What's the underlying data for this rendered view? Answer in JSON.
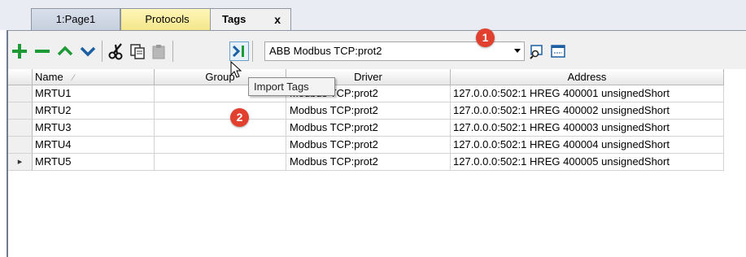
{
  "tabs": [
    {
      "label": "1:Page1"
    },
    {
      "label": "Protocols"
    },
    {
      "label": "Tags",
      "close": "x"
    }
  ],
  "toolbar": {
    "buttons": [
      "add-icon",
      "remove-icon",
      "move-up-icon",
      "move-down-icon",
      "cut-icon",
      "copy-icon",
      "paste-icon",
      "import-tags-icon"
    ],
    "protocol_selected": "ABB Modbus TCP:prot2",
    "extra_icons": [
      "tag-browser-icon",
      "window-icon"
    ]
  },
  "table": {
    "columns": [
      "Name",
      "Group",
      "Driver",
      "Address"
    ],
    "rows": [
      {
        "name": "MRTU1",
        "group": "",
        "driver": "Modbus TCP:prot2",
        "address": "127.0.0.0:502:1 HREG 400001 unsignedShort"
      },
      {
        "name": "MRTU2",
        "group": "",
        "driver": "Modbus TCP:prot2",
        "address": "127.0.0.0:502:1 HREG 400002 unsignedShort"
      },
      {
        "name": "MRTU3",
        "group": "",
        "driver": "Modbus TCP:prot2",
        "address": "127.0.0.0:502:1 HREG 400003 unsignedShort"
      },
      {
        "name": "MRTU4",
        "group": "",
        "driver": "Modbus TCP:prot2",
        "address": "127.0.0.0:502:1 HREG 400004 unsignedShort"
      },
      {
        "name": "MRTU5",
        "group": "",
        "driver": "Modbus TCP:prot2",
        "address": "127.0.0.0:502:1 HREG 400005 unsignedShort"
      }
    ],
    "current_row_marker": "▸"
  },
  "tooltip": {
    "text": "Import Tags"
  },
  "callouts": [
    "1",
    "2"
  ],
  "colors": {
    "accent_green": "#1c9a36",
    "accent_blue": "#1c5fa3",
    "badge_red": "#e2402f",
    "protocols_tab": "#f4e68a"
  }
}
